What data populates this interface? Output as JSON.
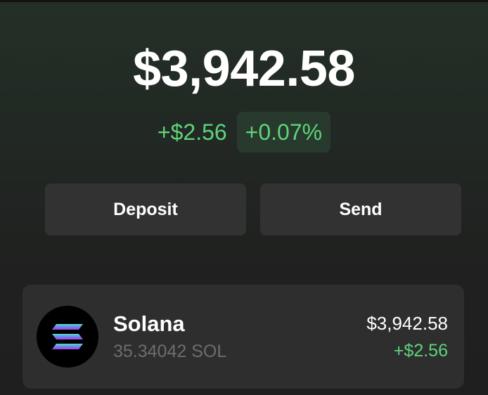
{
  "balance": {
    "total": "$3,942.58",
    "change_amount": "+$2.56",
    "change_percent": "+0.07%"
  },
  "actions": {
    "deposit_label": "Deposit",
    "send_label": "Send"
  },
  "tokens": [
    {
      "name": "Solana",
      "amount": "35.34042 SOL",
      "value": "$3,942.58",
      "change": "+$2.56",
      "icon": "solana-logo-icon"
    }
  ],
  "colors": {
    "positive": "#5fd47a",
    "background": "#1f211f",
    "card": "#2e2e2e",
    "button": "#323232"
  }
}
